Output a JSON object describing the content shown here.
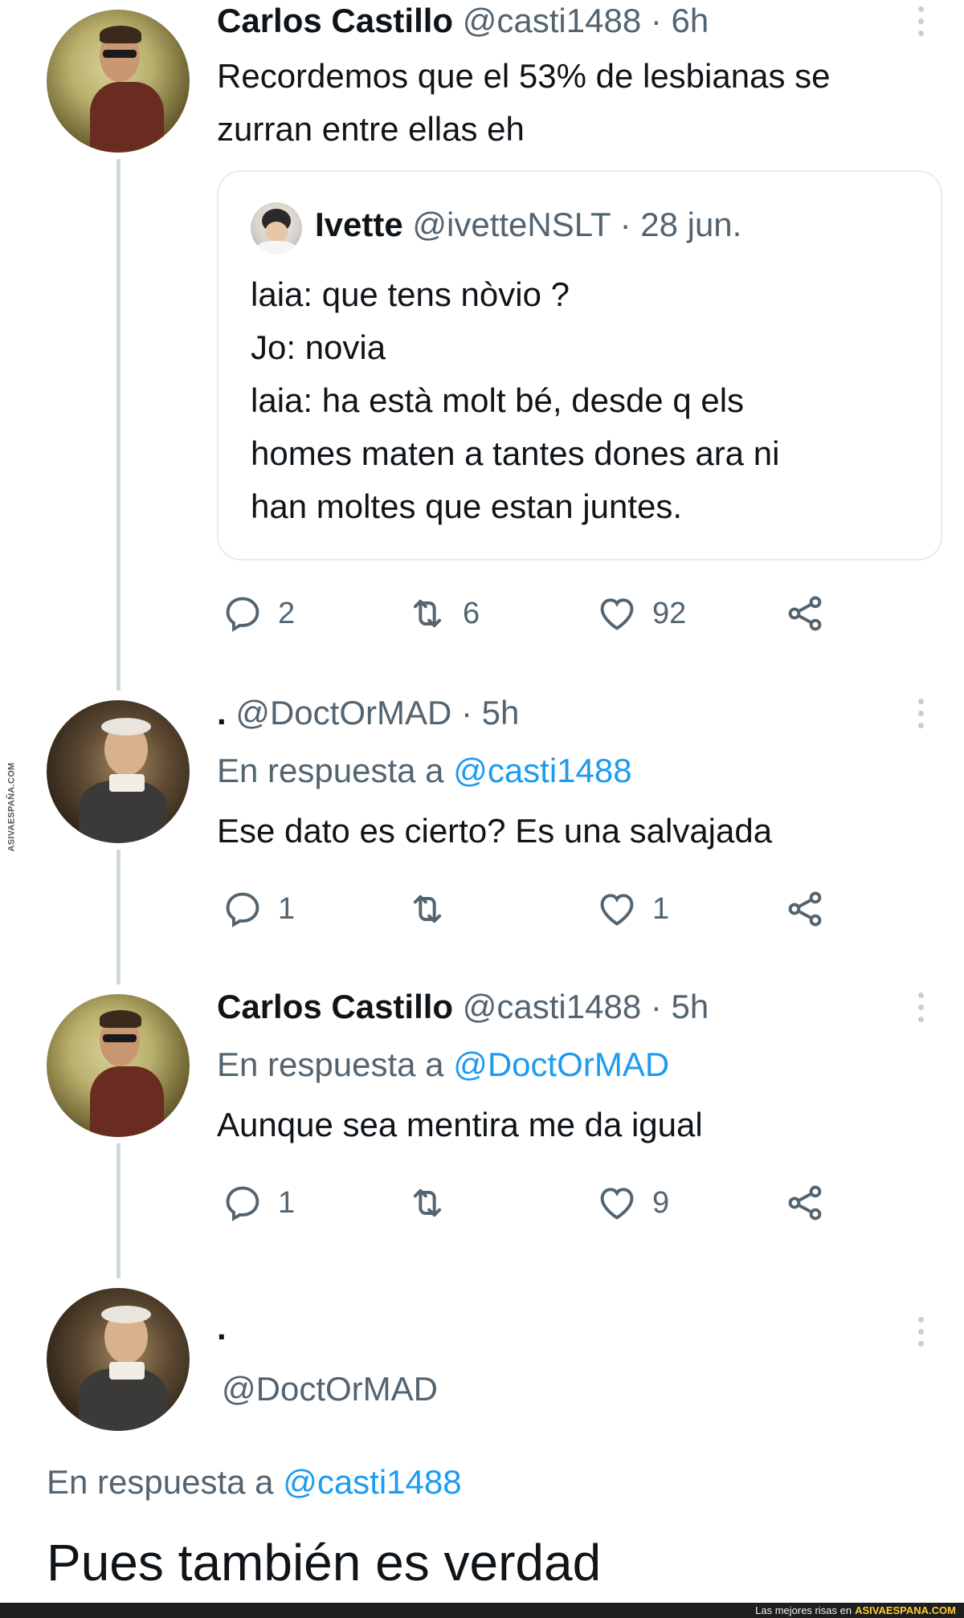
{
  "watermark": {
    "side_text": "ASIVAESPAÑA.COM"
  },
  "tweets": [
    {
      "name": "Carlos Castillo",
      "handle": "@casti1488",
      "time": "· 6h",
      "text": "Recordemos que el 53% de lesbianas se\nzurran entre ellas eh",
      "quote": {
        "name": "Ivette",
        "handle": "@ivetteNSLT",
        "time": "· 28 jun.",
        "text": "laia: que tens nòvio ?\nJo: novia\nlaia: ha està molt bé, desde q els\nhomes maten a tantes dones ara ni\nhan moltes que estan juntes."
      },
      "actions": {
        "replies": "2",
        "retweets": "6",
        "likes": "92"
      }
    },
    {
      "name": ".",
      "handle": "@DoctOrMAD",
      "time": "· 5h",
      "reply_prefix": "En respuesta a",
      "reply_mention": "@casti1488",
      "text": "Ese dato es cierto? Es una salvajada",
      "actions": {
        "replies": "1",
        "retweets": "",
        "likes": "1"
      }
    },
    {
      "name": "Carlos Castillo",
      "handle": "@casti1488",
      "time": "· 5h",
      "reply_prefix": "En respuesta a",
      "reply_mention": "@DoctOrMAD",
      "text": "Aunque sea mentira me da igual",
      "actions": {
        "replies": "1",
        "retweets": "",
        "likes": "9"
      }
    },
    {
      "name": ".",
      "handle": "@DoctOrMAD",
      "reply_prefix": "En respuesta a",
      "reply_mention": "@casti1488",
      "text": "Pues también es verdad"
    }
  ],
  "footer": {
    "text": "Las mejores risas en",
    "brand": "ASIVAESPANA.COM"
  },
  "colors": {
    "accent": "#1d9bf0",
    "muted": "#536471",
    "text": "#0f1419",
    "thread_line": "#cfd9de"
  }
}
